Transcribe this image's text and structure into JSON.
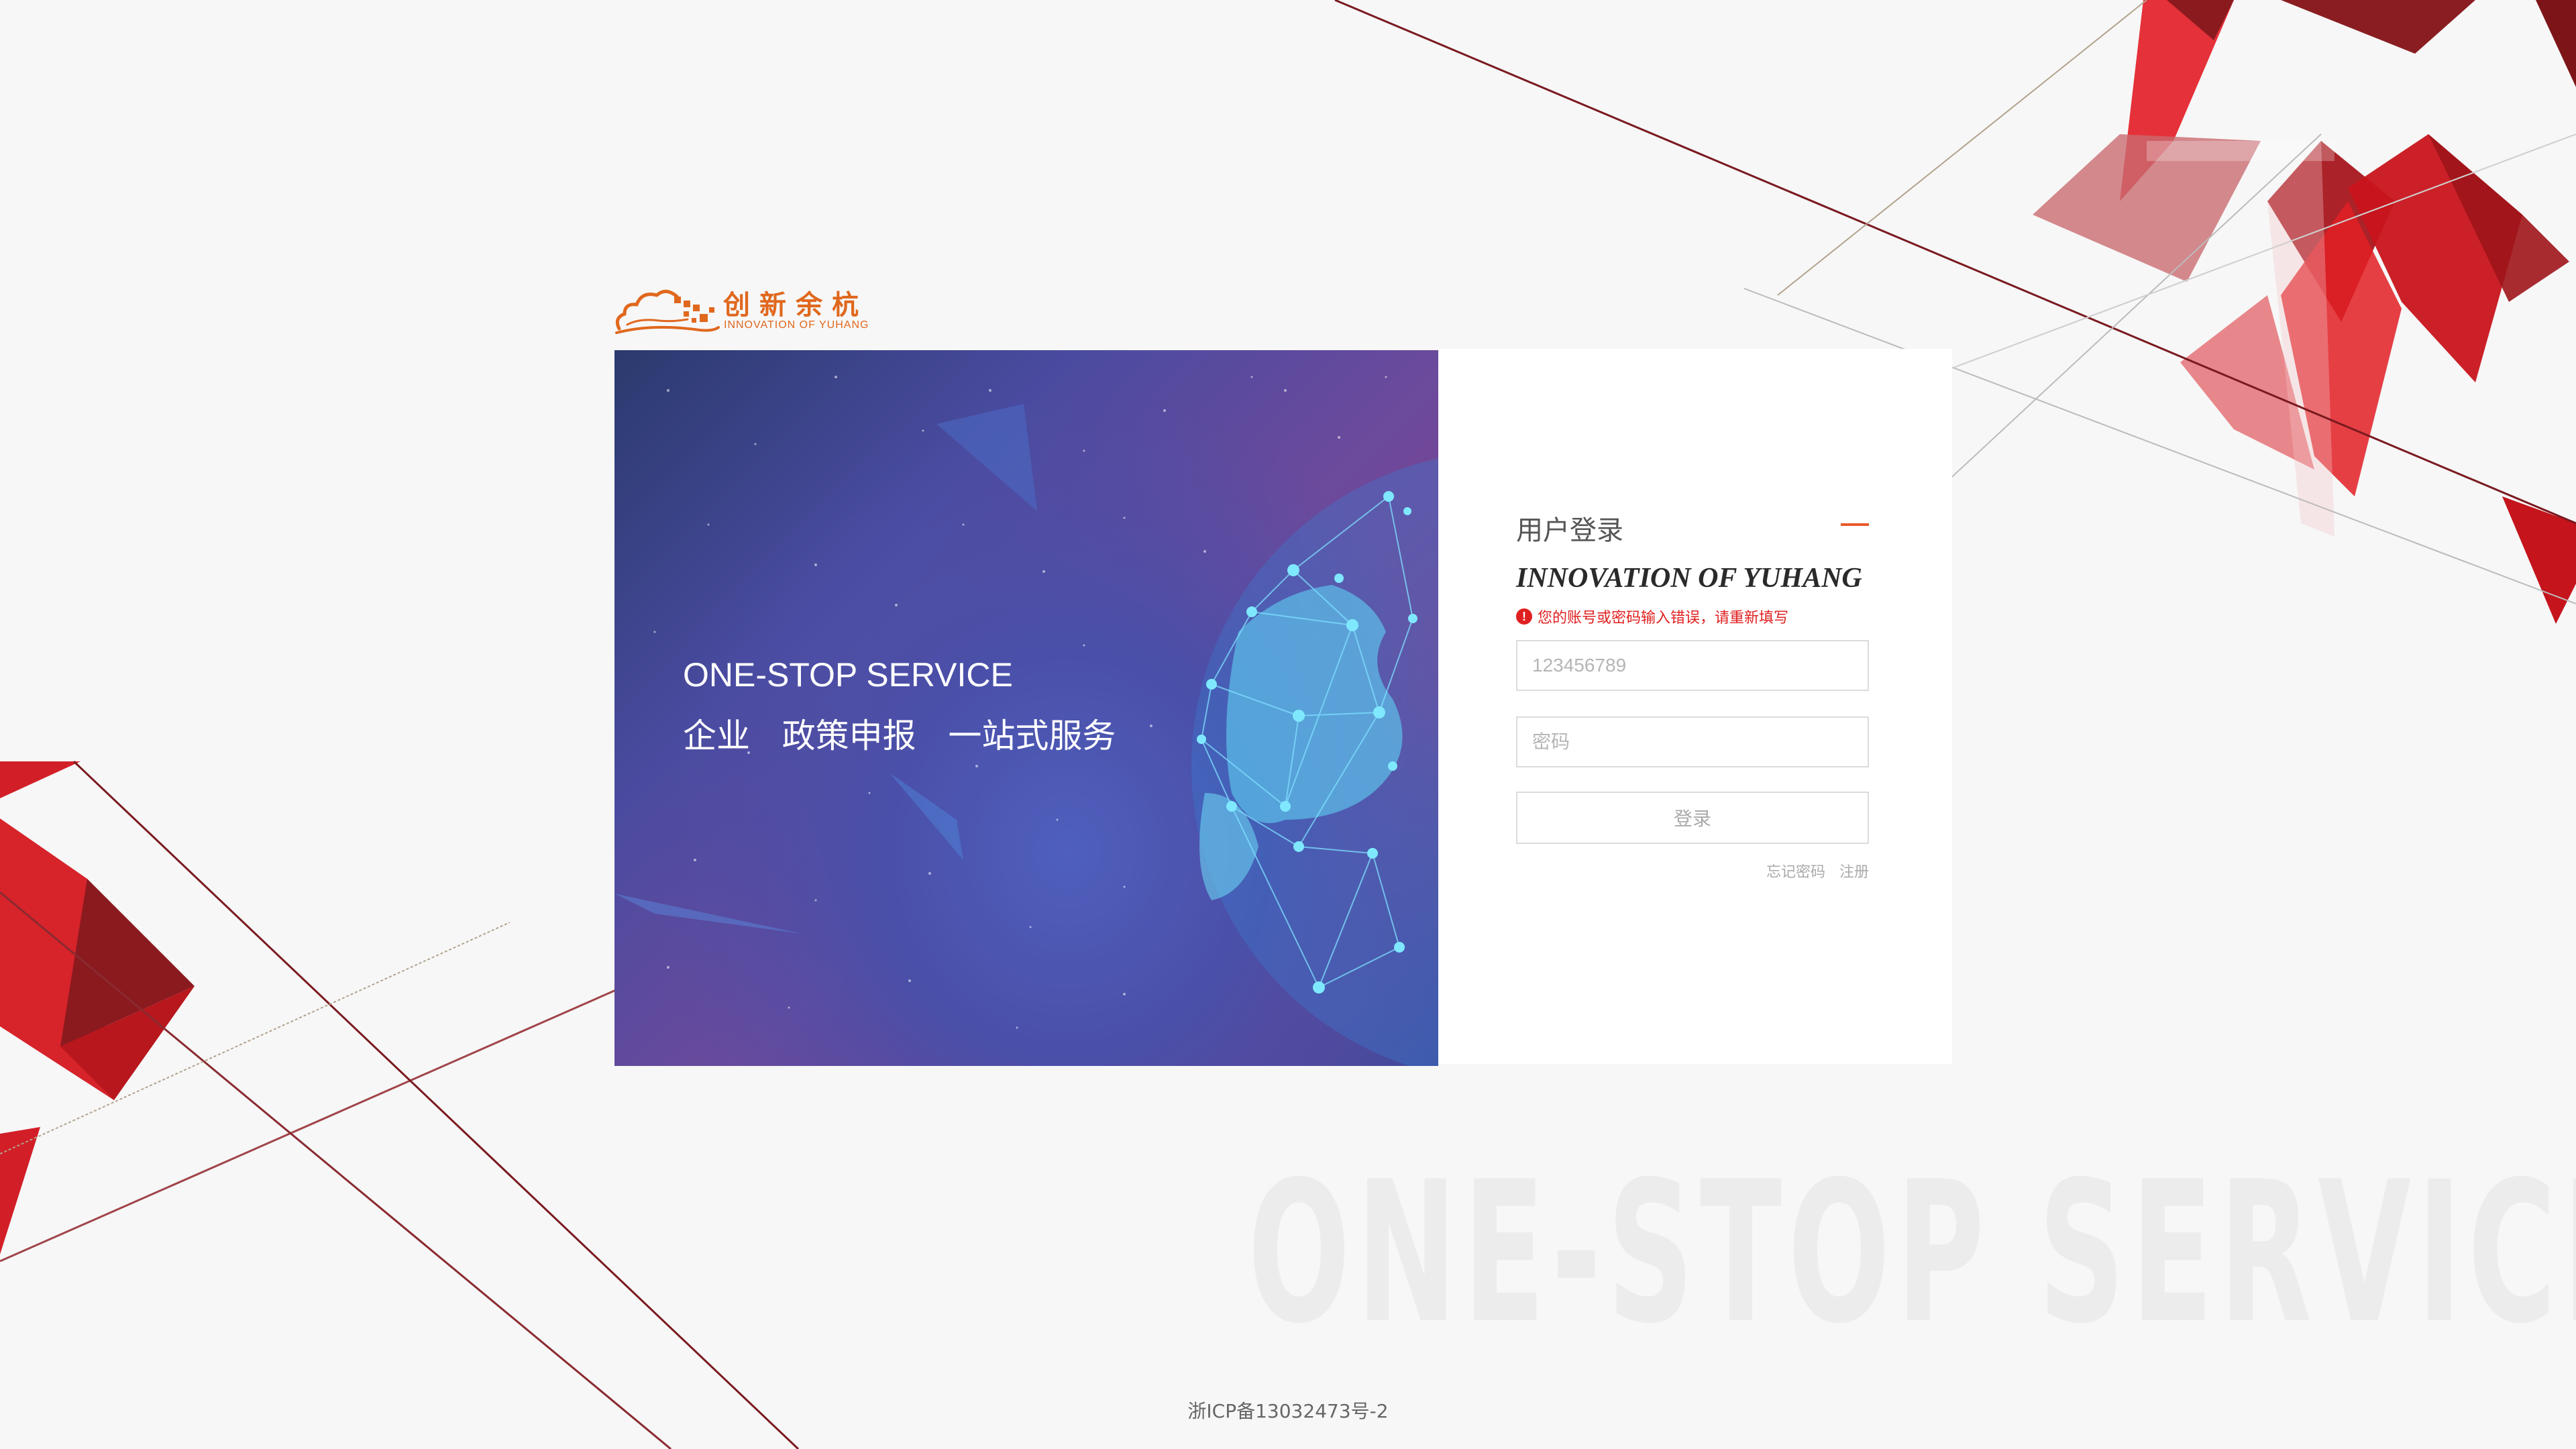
{
  "logo": {
    "name_cn": "创新余杭",
    "name_en": "INNOVATION OF YUHANG"
  },
  "hero": {
    "title_en": "ONE-STOP SERVICE",
    "title_cn": "企业   政策申报   一站式服务"
  },
  "login": {
    "title": "用户登录",
    "brand_en": "INNOVATION OF YUHANG",
    "error_message": "您的账号或密码输入错误，请重新填写",
    "username_value": "",
    "username_placeholder": "123456789",
    "password_placeholder": "密码",
    "submit_label": "登录",
    "forgot_label": "忘记密码",
    "register_label": "注册"
  },
  "watermark": "ONE-STOP SERVICE",
  "footer": {
    "icp": "浙ICP备13032473号-2"
  },
  "colors": {
    "accent_orange": "#e0681e",
    "error_red": "#e02020",
    "deco_red": "#d62528"
  },
  "icons": {
    "error": "exclamation-circle-icon",
    "logo": "cloud-pixel-logo-icon"
  }
}
